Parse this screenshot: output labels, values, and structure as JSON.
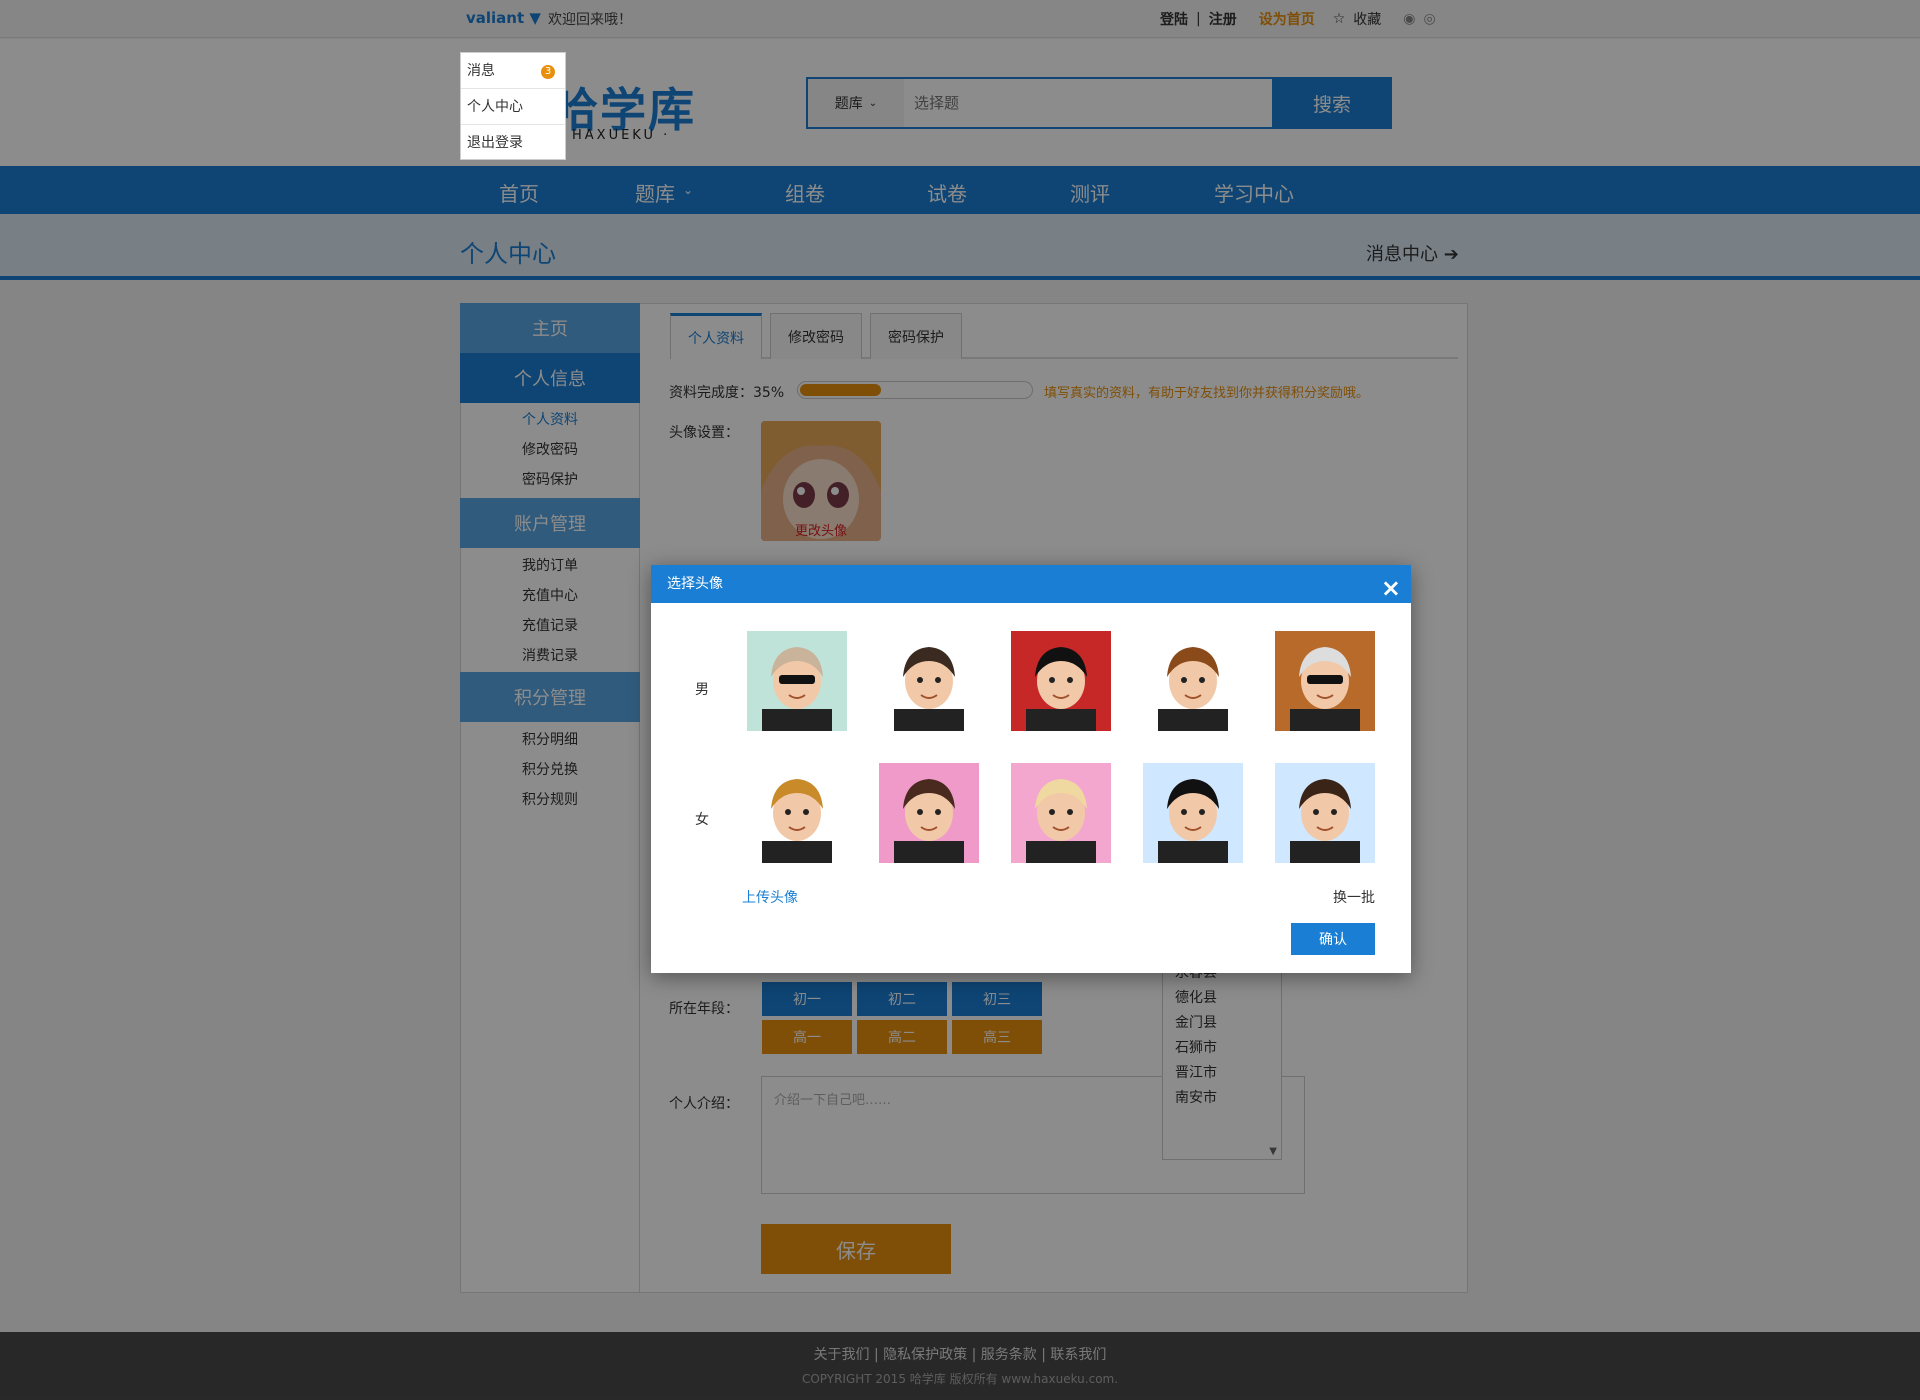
{
  "topbar": {
    "username": "valiant ▼",
    "welcome": "欢迎回来哦！",
    "login": "登陆",
    "separator": "|",
    "register": "注册",
    "set_home": "设为首页",
    "favorite": "收藏"
  },
  "user_menu": {
    "messages": "消息",
    "message_count": "3",
    "personal_center": "个人中心",
    "logout": "退出登录"
  },
  "logo": {
    "text": "哈学库",
    "sub": "HAXUEKU ·"
  },
  "search": {
    "category": "题库",
    "placeholder": "选择题",
    "button": "搜索"
  },
  "nav": {
    "items": [
      "首页",
      "题库",
      "组卷",
      "试卷",
      "测评",
      "学习中心"
    ]
  },
  "subheader": {
    "title": "个人中心",
    "message_center": "消息中心 ➔"
  },
  "sidebar": {
    "home": "主页",
    "personal_info": "个人信息",
    "personal_items": [
      "个人资料",
      "修改密码",
      "密码保护"
    ],
    "account": "账户管理",
    "account_items": [
      "我的订单",
      "充值中心",
      "充值记录",
      "消费记录"
    ],
    "points": "积分管理",
    "points_items": [
      "积分明细",
      "积分兑换",
      "积分规则"
    ]
  },
  "tabs": [
    "个人资料",
    "修改密码",
    "密码保护"
  ],
  "profile": {
    "completion_label": "资料完成度：35%",
    "completion_value": 0.35,
    "completion_hint": "填写真实的资料，有助于好友找到你并获得积分奖励哦。",
    "avatar_label": "头像设置：",
    "avatar_change": "更改头像",
    "grade_label": "所在年段：",
    "grades_junior": [
      "初一",
      "初二",
      "初三"
    ],
    "grades_senior": [
      "高一",
      "高二",
      "高三"
    ],
    "intro_label": "个人介绍：",
    "intro_placeholder": "介绍一下自己吧……",
    "save": "保存"
  },
  "city_list": [
    "永春县",
    "德化县",
    "金门县",
    "石狮市",
    "晋江市",
    "南安市"
  ],
  "modal": {
    "title": "选择头像",
    "close": "×",
    "male": "男",
    "female": "女",
    "upload": "上传头像",
    "change_batch": "换一批",
    "confirm": "确认"
  },
  "footer": {
    "links": "关于我们   |   隐私保护政策   |   服务条款   |   联系我们",
    "copyright": "COPYRIGHT 2015  哈学库  版权所有  www.haxueku.com."
  },
  "colors": {
    "primary": "#1a7fd4",
    "accent": "#e8900e",
    "footer": "#4a4a4a"
  }
}
